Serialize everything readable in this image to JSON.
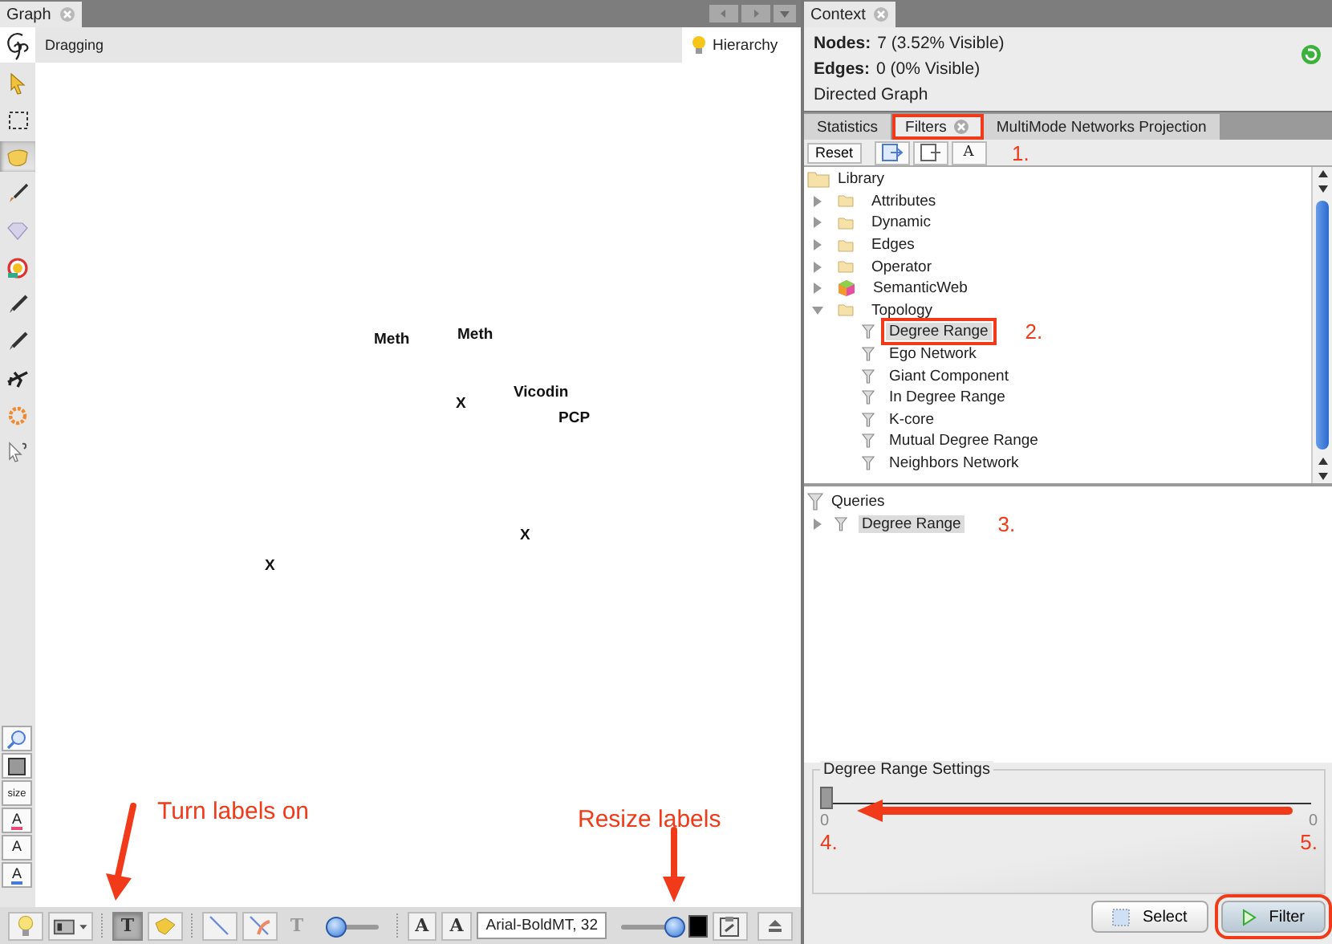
{
  "graph_panel": {
    "tab": "Graph",
    "mode": "Dragging",
    "hierarchy": "Hierarchy",
    "tools": [
      {
        "kind": "pointer",
        "selected": false
      },
      {
        "kind": "rectangle-select",
        "selected": false
      },
      {
        "kind": "hand",
        "selected": true
      },
      {
        "kind": "brush",
        "selected": false
      },
      {
        "kind": "diamond",
        "selected": false
      },
      {
        "kind": "palette",
        "selected": false
      },
      {
        "kind": "pencil",
        "selected": false
      },
      {
        "kind": "pencil",
        "selected": false
      },
      {
        "kind": "plane",
        "selected": false
      },
      {
        "kind": "sun",
        "selected": false
      },
      {
        "kind": "cursor-help",
        "selected": false
      }
    ],
    "label_tools": [
      {
        "kind": "zoom"
      },
      {
        "kind": "square"
      },
      {
        "kind": "text",
        "label": "size"
      },
      {
        "kind": "font-color",
        "label": "A"
      },
      {
        "kind": "font-size",
        "label": "A"
      },
      {
        "kind": "font-underline",
        "label": "A"
      }
    ],
    "nodes": [
      {
        "label": "Meth"
      },
      {
        "label": "Meth"
      },
      {
        "label": "X"
      },
      {
        "label": "Vicodin"
      },
      {
        "label": "PCP"
      },
      {
        "label": "X"
      },
      {
        "label": "X"
      }
    ],
    "callouts": [
      "Turn labels on",
      "Resize labels"
    ],
    "toolbar": [
      {
        "kind": "bulb"
      },
      {
        "kind": "screenshot"
      },
      {
        "kind": "separator"
      },
      {
        "kind": "text-button",
        "label": "T",
        "selected": true,
        "disabled": false
      },
      {
        "kind": "flag"
      },
      {
        "kind": "separator"
      },
      {
        "kind": "edge-line"
      },
      {
        "kind": "edge-color"
      },
      {
        "kind": "text-button",
        "label": "T",
        "selected": false,
        "disabled": true
      },
      {
        "kind": "slider",
        "level": 0.15
      },
      {
        "kind": "separator"
      },
      {
        "kind": "text-button",
        "label": "A",
        "selected": false,
        "disabled": false
      },
      {
        "kind": "text-button",
        "label": "A",
        "selected": false,
        "disabled": false
      },
      {
        "kind": "field",
        "value": "Arial-BoldMT, 32"
      },
      {
        "kind": "slider",
        "level": 0.9
      },
      {
        "kind": "swatch",
        "color": "#000000"
      },
      {
        "kind": "clipboard"
      },
      {
        "kind": "spacer"
      },
      {
        "kind": "eject"
      }
    ]
  },
  "context_panel": {
    "tab": "Context",
    "rows": [
      {
        "label": "Nodes:",
        "value": "7 (3.52% Visible)"
      },
      {
        "label": "Edges:",
        "value": "0 (0% Visible)"
      }
    ],
    "graph_type": "Directed Graph"
  },
  "filters_panel": {
    "tabs": [
      {
        "label": "Statistics",
        "selected": false,
        "closable": false,
        "highlighted": false
      },
      {
        "label": "Filters",
        "selected": true,
        "closable": true,
        "highlighted": true
      },
      {
        "label": "MultiMode Networks Projection",
        "selected": false,
        "closable": false,
        "highlighted": false
      }
    ],
    "toolbar": {
      "reset": "Reset",
      "icons": [
        {
          "kind": "export"
        },
        {
          "kind": "save"
        },
        {
          "kind": "text",
          "label": "A"
        }
      ],
      "step": "1."
    },
    "library": {
      "label": "Library",
      "children": [
        {
          "label": "Attributes",
          "kind": "folder",
          "expanded": false,
          "selected": false
        },
        {
          "label": "Dynamic",
          "kind": "folder",
          "expanded": false,
          "selected": false
        },
        {
          "label": "Edges",
          "kind": "folder",
          "expanded": false,
          "selected": false
        },
        {
          "label": "Operator",
          "kind": "folder",
          "expanded": false,
          "selected": false
        },
        {
          "label": "SemanticWeb",
          "kind": "cube",
          "expanded": false,
          "selected": false
        },
        {
          "label": "Topology",
          "kind": "folder",
          "expanded": true,
          "selected": false,
          "children": [
            {
              "label": "Degree Range",
              "selected": true,
              "highlighted": true,
              "step": "2."
            },
            {
              "label": "Ego Network",
              "selected": false,
              "highlighted": false
            },
            {
              "label": "Giant Component",
              "selected": false,
              "highlighted": false
            },
            {
              "label": "In Degree Range",
              "selected": false,
              "highlighted": false
            },
            {
              "label": "K-core",
              "selected": false,
              "highlighted": false
            },
            {
              "label": "Mutual Degree Range",
              "selected": false,
              "highlighted": false
            },
            {
              "label": "Neighbors Network",
              "selected": false,
              "highlighted": false
            }
          ]
        }
      ]
    },
    "queries": {
      "label": "Queries",
      "items": [
        {
          "label": "Degree Range",
          "selected": true,
          "expanded": false,
          "step": "3."
        }
      ]
    },
    "settings": {
      "title": "Degree Range Settings",
      "level": 0,
      "min": "0",
      "max": "0",
      "steps": [
        "4.",
        "5."
      ]
    },
    "buttons": [
      {
        "label": "Select",
        "kind": "select",
        "highlighted": false
      },
      {
        "label": "Filter",
        "kind": "filter",
        "highlighted": true
      }
    ]
  }
}
